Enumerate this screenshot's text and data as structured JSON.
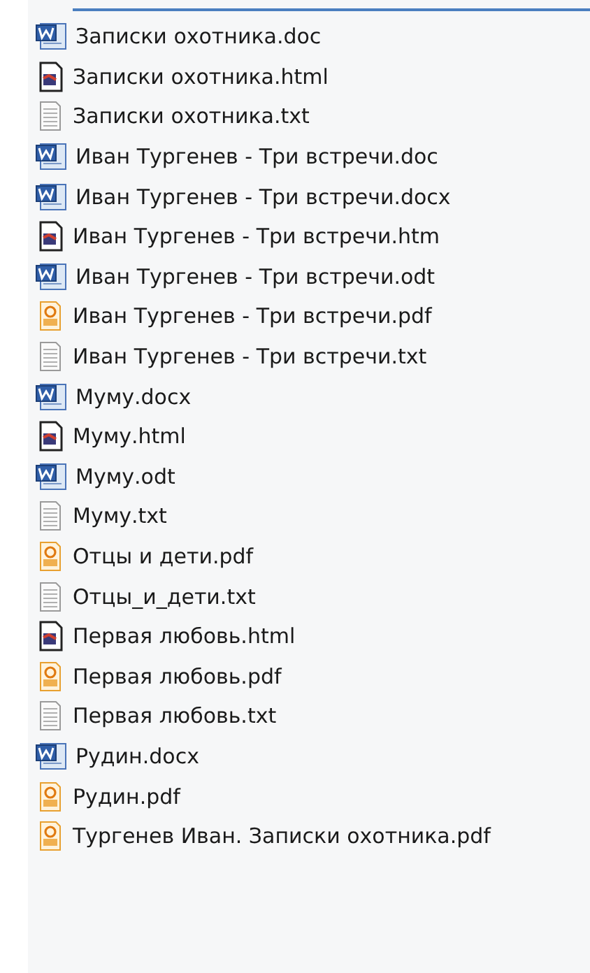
{
  "files": [
    {
      "name": "Записки охотника.doc",
      "kind": "word"
    },
    {
      "name": "Записки охотника.html",
      "kind": "html"
    },
    {
      "name": "Записки охотника.txt",
      "kind": "text"
    },
    {
      "name": "Иван Тургенев - Три встречи.doc",
      "kind": "word"
    },
    {
      "name": "Иван Тургенев - Три встречи.docx",
      "kind": "word"
    },
    {
      "name": "Иван Тургенев - Три встречи.htm",
      "kind": "html"
    },
    {
      "name": "Иван Тургенев - Три встречи.odt",
      "kind": "word"
    },
    {
      "name": "Иван Тургенев - Три встречи.pdf",
      "kind": "pdf"
    },
    {
      "name": "Иван Тургенев - Три встречи.txt",
      "kind": "text"
    },
    {
      "name": "Муму.docx",
      "kind": "word"
    },
    {
      "name": "Муму.html",
      "kind": "html"
    },
    {
      "name": "Муму.odt",
      "kind": "word"
    },
    {
      "name": "Муму.txt",
      "kind": "text"
    },
    {
      "name": "Отцы и дети.pdf",
      "kind": "pdf"
    },
    {
      "name": "Отцы_и_дети.txt",
      "kind": "text"
    },
    {
      "name": "Первая любовь.html",
      "kind": "html"
    },
    {
      "name": "Первая любовь.pdf",
      "kind": "pdf"
    },
    {
      "name": "Первая любовь.txt",
      "kind": "text"
    },
    {
      "name": "Рудин.docx",
      "kind": "word"
    },
    {
      "name": "Рудин.pdf",
      "kind": "pdf"
    },
    {
      "name": "Тургенев Иван. Записки охотника.pdf",
      "kind": "pdf"
    }
  ]
}
